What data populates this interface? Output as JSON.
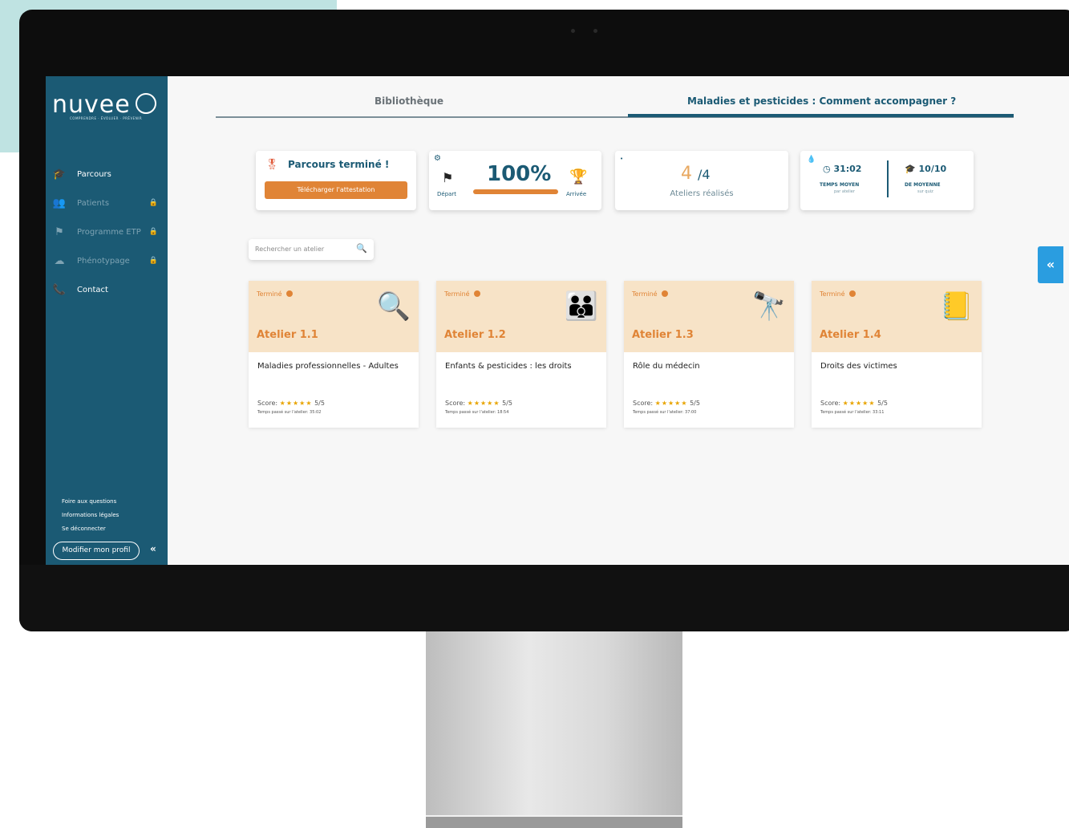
{
  "sidebar": {
    "logo": "nuvee",
    "logo_subtitle": "COMPRENDRE · ÉVOLUER · PRÉVENIR",
    "items": [
      {
        "label": "Parcours",
        "icon": "graduation-cap-icon",
        "locked": false
      },
      {
        "label": "Patients",
        "icon": "users-icon",
        "locked": true
      },
      {
        "label": "Programme ETP",
        "icon": "flag-icon",
        "locked": true
      },
      {
        "label": "Phénotypage",
        "icon": "chart-icon",
        "locked": true
      },
      {
        "label": "Contact",
        "icon": "phone-icon",
        "locked": false
      }
    ],
    "footer_links": [
      "Foire aux questions",
      "Informations légales",
      "Se déconnecter"
    ],
    "profile_button": "Modifier mon profil"
  },
  "tabs": [
    {
      "label": "Bibliothèque",
      "active": false
    },
    {
      "label": "Maladies et pesticides : Comment accompagner ?",
      "active": true
    }
  ],
  "stats": {
    "completion": {
      "title": "Parcours terminé !",
      "button": "Télécharger l'attestation"
    },
    "progress": {
      "value": "100%",
      "fraction": 1.0,
      "start_label": "Départ",
      "end_label": "Arrivée"
    },
    "ateliers": {
      "done": "4",
      "total": "/4",
      "label": "Ateliers réalisés"
    },
    "time": {
      "value": "31:02",
      "label": "TEMPS MOYEN",
      "sub": "par atelier"
    },
    "average": {
      "value": "10/10",
      "label": "DE MOYENNE",
      "sub": "sur quiz"
    }
  },
  "search": {
    "placeholder": "Rechercher un atelier"
  },
  "cards": [
    {
      "status": "Terminé",
      "atelier": "Atelier 1.1",
      "title": "Maladies professionnelles - Adultes",
      "score_label": "Score:",
      "stars": "★★★★★",
      "score": "5/5",
      "time": "Temps passé sur l'atelier: 35:02"
    },
    {
      "status": "Terminé",
      "atelier": "Atelier 1.2",
      "title": "Enfants & pesticides : les droits",
      "score_label": "Score:",
      "stars": "★★★★★",
      "score": "5/5",
      "time": "Temps passé sur l'atelier: 18:54"
    },
    {
      "status": "Terminé",
      "atelier": "Atelier 1.3",
      "title": "Rôle du médecin",
      "score_label": "Score:",
      "stars": "★★★★★",
      "score": "5/5",
      "time": "Temps passé sur l'atelier: 37:00"
    },
    {
      "status": "Terminé",
      "atelier": "Atelier 1.4",
      "title": "Droits des victimes",
      "score_label": "Score:",
      "stars": "★★★★★",
      "score": "5/5",
      "time": "Temps passé sur l'atelier: 33:11"
    }
  ],
  "colors": {
    "brand": "#1b5a74",
    "accent": "#e08436",
    "card_header": "#f7e3c7",
    "collapse_button": "#2a9de0"
  }
}
